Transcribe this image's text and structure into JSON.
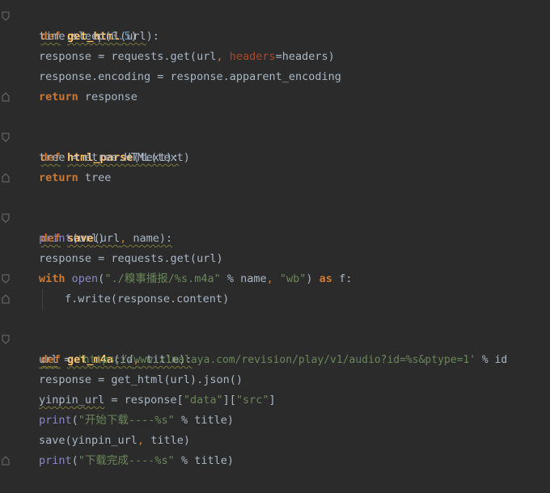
{
  "code": {
    "l1": {
      "kw": "def",
      "name": "get_html",
      "open": "(",
      "p1": "url",
      "close": "):"
    },
    "l2": {
      "a": "time.sleep(",
      "num": "0.5",
      "b": ")"
    },
    "l3": {
      "a": "response = requests.get(url",
      "comma": ",",
      "kwarg": "headers",
      "b": "=headers)"
    },
    "l4": {
      "a": "response.encoding = response.apparent_encoding"
    },
    "l5": {
      "kw": "return",
      "a": " response"
    },
    "l7": {
      "kw": "def",
      "name": "html_parse",
      "a": "(text):"
    },
    "l8": {
      "a": "tree = etree.HTML(text)"
    },
    "l9": {
      "kw": "return",
      "a": " tree"
    },
    "l11": {
      "kw": "def",
      "name": "save",
      "open": "(",
      "p1": "url",
      "comma": ",",
      "p2": " name",
      "close": "):"
    },
    "l12": {
      "builtin": "print",
      "a": "(url)"
    },
    "l13": {
      "a": "response = requests.get(url)"
    },
    "l14": {
      "kw": "with",
      "builtin": "open",
      "open": "(",
      "str1": "\"./糗事播报/%s.m4a\"",
      "a": " % name",
      "comma": ",",
      "str2": " \"wb\"",
      "close": ") ",
      "kw2": "as",
      "b": " f:"
    },
    "l15": {
      "a": "f.write(response.content)"
    },
    "l17": {
      "kw": "def",
      "name": "get_m4a",
      "open": "(",
      "p1": "id",
      "comma": ",",
      "p2": " title",
      "close": "):"
    },
    "l18": {
      "var": "url",
      "a": " = ",
      "str": "'https://www.ximalaya.com/revision/play/v1/audio?id=%s&ptype=1'",
      "b": " % id"
    },
    "l19": {
      "a": "response = get_html(url).json()"
    },
    "l20": {
      "var": "yinpin_url",
      "a": " = response[",
      "s1": "\"data\"",
      "m": "][",
      "s2": "\"src\"",
      "b": "]"
    },
    "l21": {
      "builtin": "print",
      "open": "(",
      "str": "\"开始下载----%s\"",
      "a": " % title)"
    },
    "l22": {
      "a": "save(yinpin_url",
      "comma": ",",
      "b": " title)"
    },
    "l23": {
      "builtin": "print",
      "open": "(",
      "str": "\"下载完成----%s\"",
      "a": " % title)"
    }
  },
  "colors": {
    "background": "#2b2b2b",
    "keyword": "#cc7832",
    "function": "#ffc66d",
    "string": "#6a8759",
    "number": "#6897bb",
    "builtin": "#8888c6",
    "text": "#a9b7c6"
  }
}
